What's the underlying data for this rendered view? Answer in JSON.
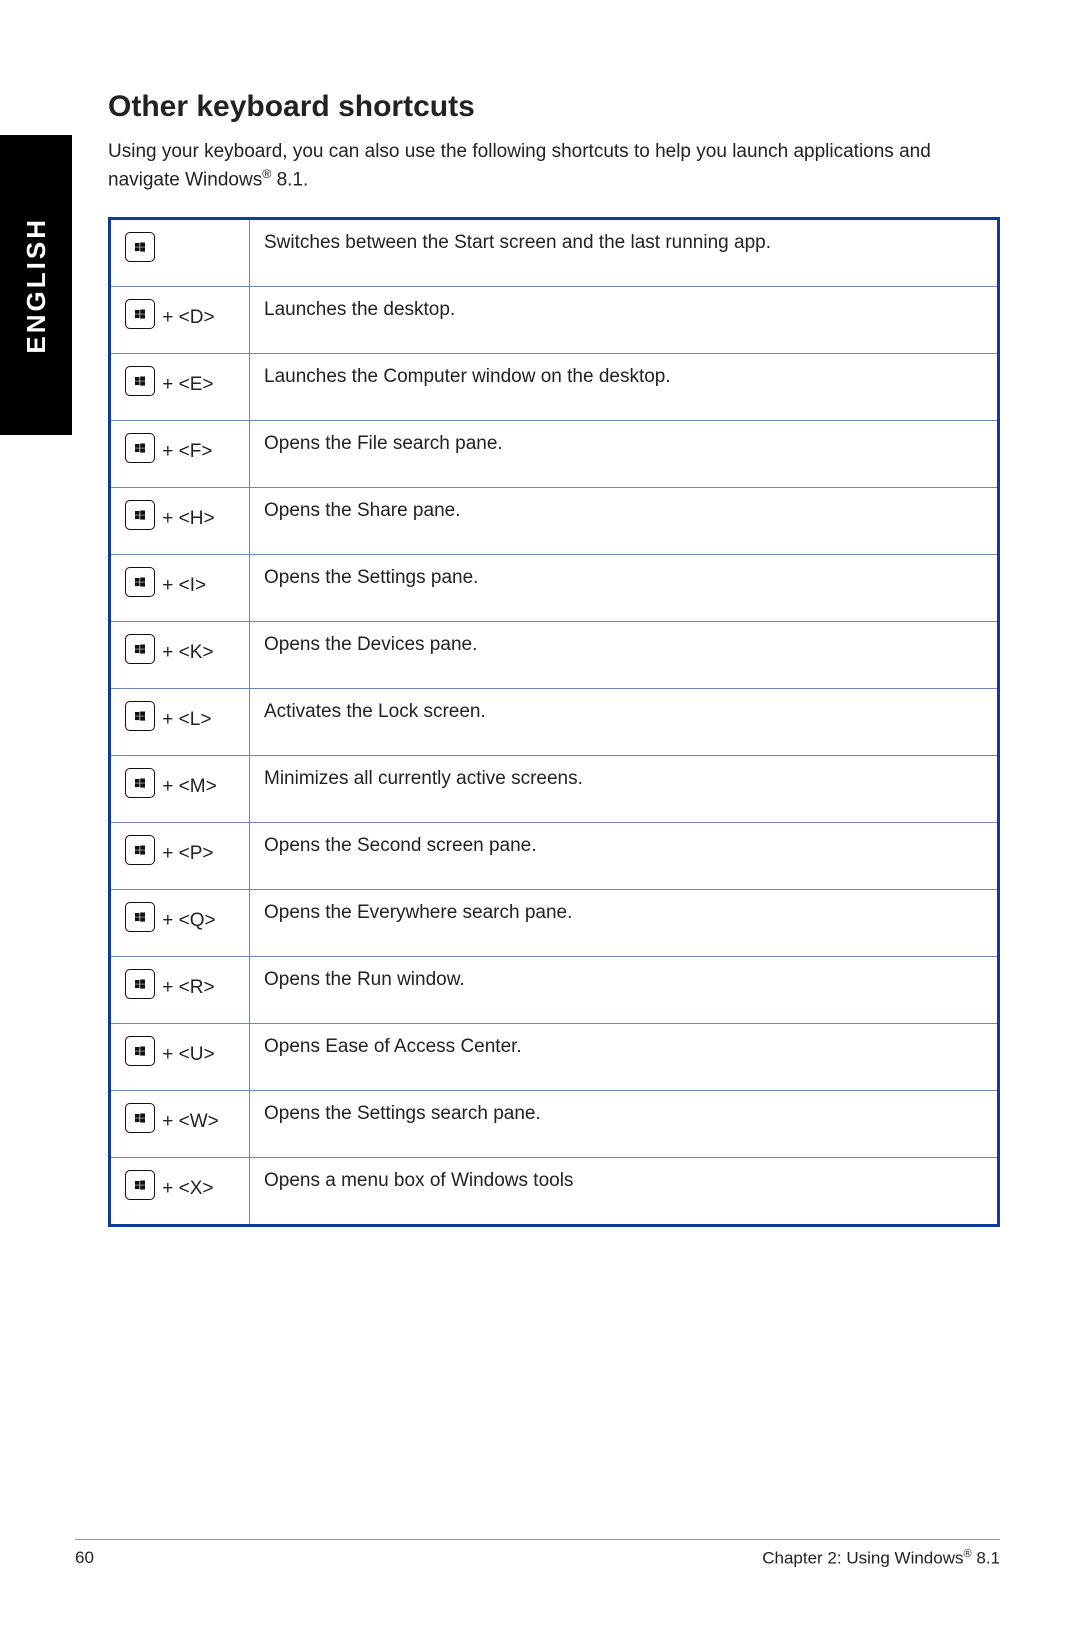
{
  "language_tab": "ENGLISH",
  "heading": "Other keyboard shortcuts",
  "intro_pre": "Using your keyboard, you can also use the following shortcuts to help you launch applications and navigate Windows",
  "intro_reg": "®",
  "intro_post": " 8.1.",
  "shortcuts": [
    {
      "suffix": "",
      "desc": "Switches between the Start screen and the last running app."
    },
    {
      "suffix": " + <D>",
      "desc": "Launches the desktop."
    },
    {
      "suffix": " + <E>",
      "desc": "Launches the Computer window on the desktop."
    },
    {
      "suffix": " + <F>",
      "desc": "Opens the File search pane."
    },
    {
      "suffix": " + <H>",
      "desc": "Opens the Share pane."
    },
    {
      "suffix": " + <I>",
      "desc": "Opens the Settings pane."
    },
    {
      "suffix": " + <K>",
      "desc": "Opens the Devices pane."
    },
    {
      "suffix": " + <L>",
      "desc": "Activates the Lock screen."
    },
    {
      "suffix": " + <M>",
      "desc": "Minimizes all currently active screens."
    },
    {
      "suffix": " + <P>",
      "desc": "Opens the Second screen pane."
    },
    {
      "suffix": " + <Q>",
      "desc": "Opens the Everywhere search pane."
    },
    {
      "suffix": " + <R>",
      "desc": "Opens the Run window."
    },
    {
      "suffix": " + <U>",
      "desc": "Opens Ease of Access Center."
    },
    {
      "suffix": " + <W>",
      "desc": "Opens the Settings search pane."
    },
    {
      "suffix": " + <X>",
      "desc": "Opens a menu box of Windows tools"
    }
  ],
  "footer": {
    "page_number": "60",
    "chapter_pre": "Chapter 2: Using Windows",
    "chapter_reg": "®",
    "chapter_post": " 8.1"
  }
}
